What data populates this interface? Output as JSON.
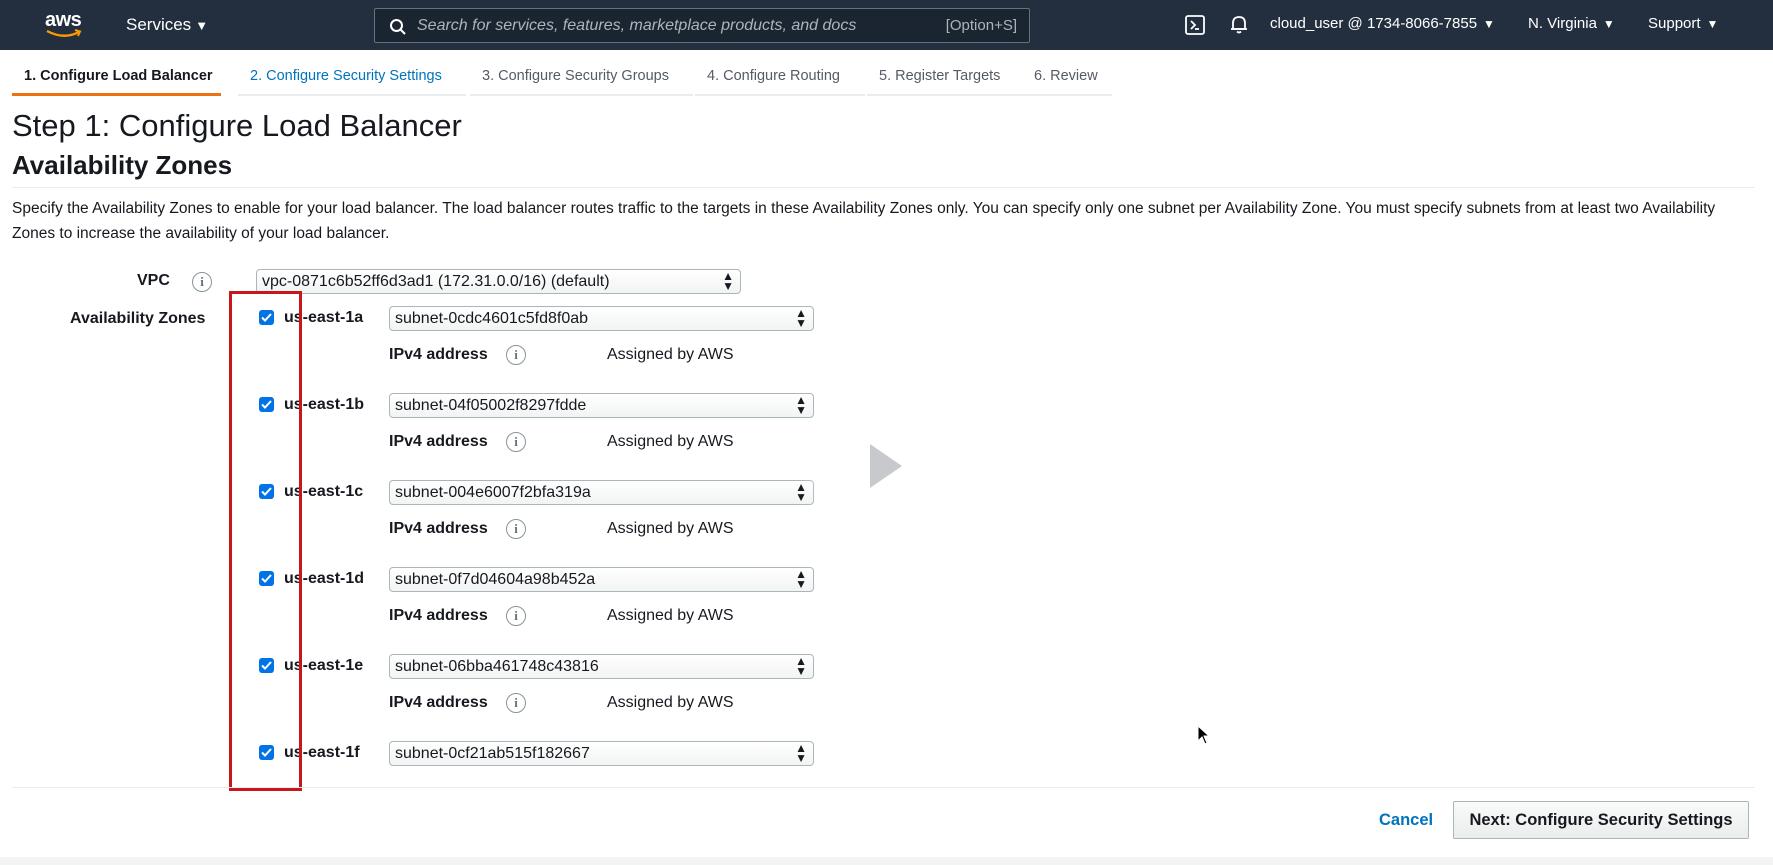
{
  "topnav": {
    "logo_text": "aws",
    "services_label": "Services",
    "search_placeholder": "Search for services, features, marketplace products, and docs",
    "search_shortcut": "[Option+S]",
    "account": "cloud_user @ 1734-8066-7855",
    "region": "N. Virginia",
    "support": "Support"
  },
  "tabs": [
    {
      "label": "1. Configure Load Balancer"
    },
    {
      "label": "2. Configure Security Settings"
    },
    {
      "label": "3. Configure Security Groups"
    },
    {
      "label": "4. Configure Routing"
    },
    {
      "label": "5. Register Targets"
    },
    {
      "label": "6. Review"
    }
  ],
  "page_title": "Step 1: Configure Load Balancer",
  "section_title": "Availability Zones",
  "description": "Specify the Availability Zones to enable for your load balancer. The load balancer routes traffic to the targets in these Availability Zones only. You can specify only one subnet per Availability Zone. You must specify subnets from at least two Availability Zones to increase the availability of your load balancer.",
  "vpc": {
    "label": "VPC",
    "value": "vpc-0871c6b52ff6d3ad1 (172.31.0.0/16) (default)"
  },
  "az_label": "Availability Zones",
  "ipv4_label": "IPv4 address",
  "ipv4_value": "Assigned by AWS",
  "zones": [
    {
      "name": "us-east-1a",
      "subnet": "subnet-0cdc4601c5fd8f0ab",
      "checked": true
    },
    {
      "name": "us-east-1b",
      "subnet": "subnet-04f05002f8297fdde",
      "checked": true
    },
    {
      "name": "us-east-1c",
      "subnet": "subnet-004e6007f2bfa319a",
      "checked": true
    },
    {
      "name": "us-east-1d",
      "subnet": "subnet-0f7d04604a98b452a",
      "checked": true
    },
    {
      "name": "us-east-1e",
      "subnet": "subnet-06bba461748c43816",
      "checked": true
    },
    {
      "name": "us-east-1f",
      "subnet": "subnet-0cf21ab515f182667",
      "checked": true
    }
  ],
  "actions": {
    "cancel": "Cancel",
    "next": "Next: Configure Security Settings"
  },
  "colors": {
    "nav_bg": "#232f3e",
    "accent_orange": "#ec7211",
    "link_blue": "#0073bb",
    "highlight_red": "#c7161c"
  }
}
